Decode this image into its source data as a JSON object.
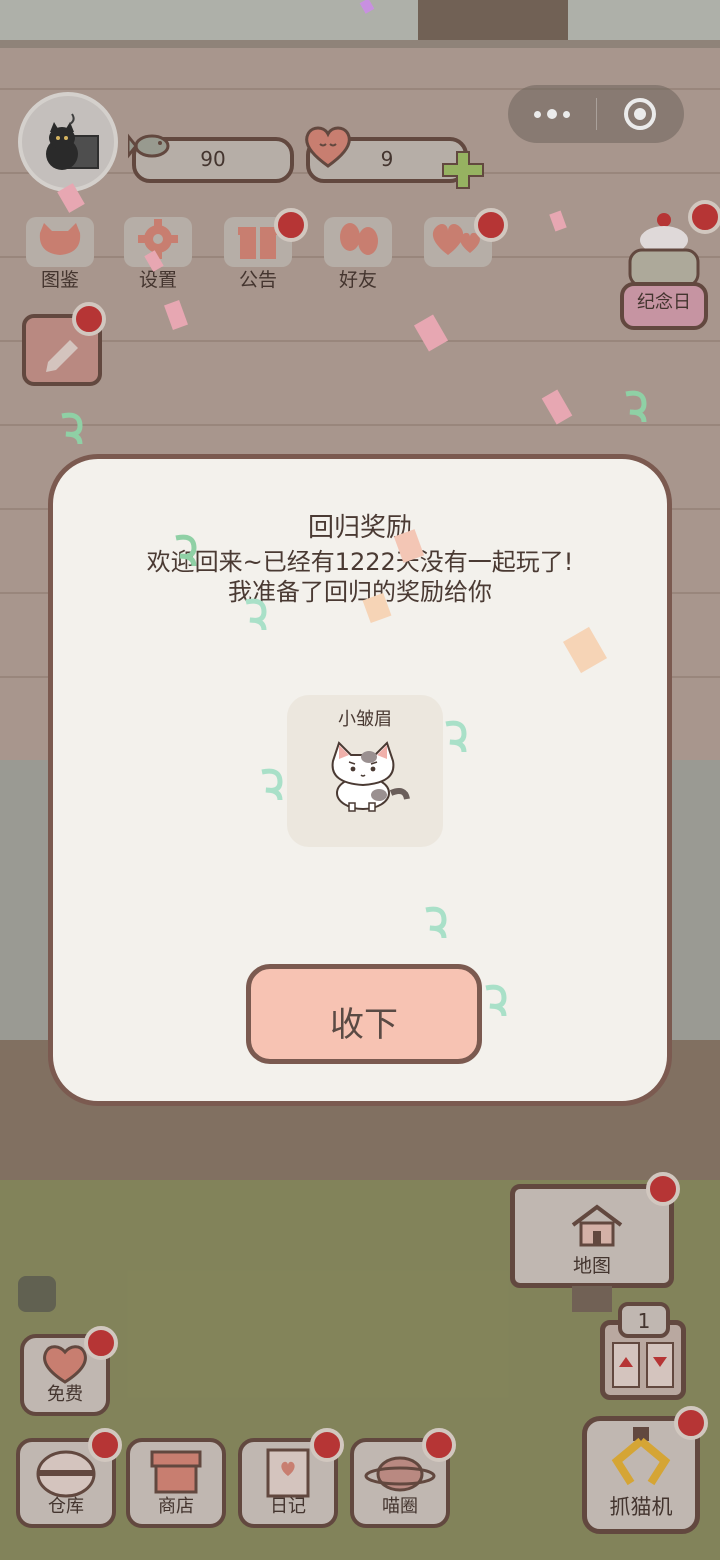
{
  "status": {
    "fish_count": "90",
    "heart_count": "9"
  },
  "menu": {
    "items": [
      {
        "label": "图鉴"
      },
      {
        "label": "设置"
      },
      {
        "label": "公告"
      },
      {
        "label": "好友"
      }
    ],
    "anniversary_label": "纪念日"
  },
  "modal": {
    "title": "回归奖励",
    "message_line1": "欢迎回来~已经有1222天没有一起玩了!",
    "message_line2": "我准备了回归的奖励给你",
    "reward_name": "小皱眉",
    "accept_label": "收下"
  },
  "map": {
    "label": "地图"
  },
  "elevator": {
    "floor": "1"
  },
  "bottom_nav": {
    "free_label": "免费",
    "warehouse_label": "仓库",
    "shop_label": "商店",
    "diary_label": "日记",
    "circle_label": "喵圈",
    "claw_label": "抓猫机"
  },
  "colors": {
    "accent_red": "#c63a3a",
    "button_pink": "#f7c3b3",
    "border_brown": "#6b4f45"
  }
}
